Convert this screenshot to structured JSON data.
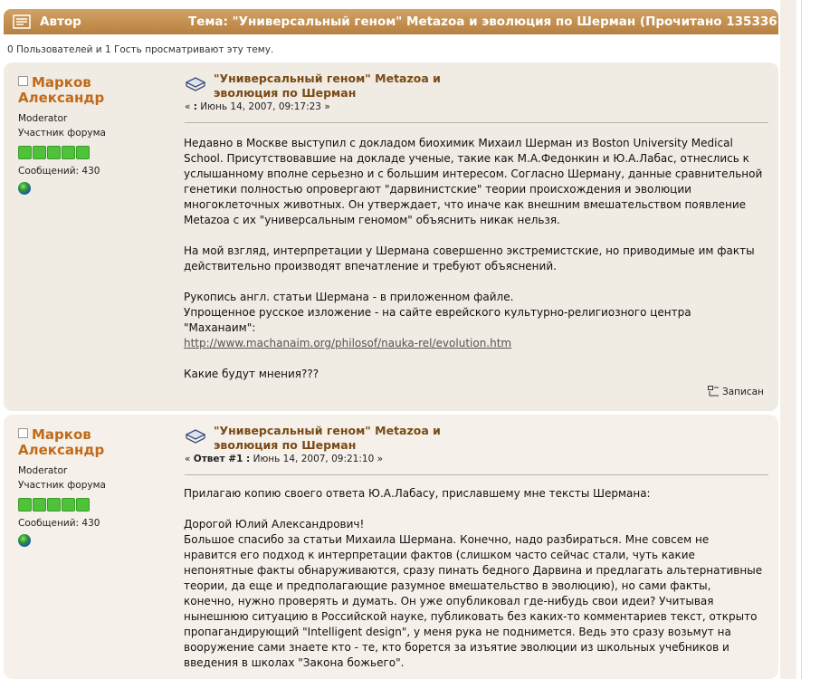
{
  "header": {
    "author_col": "Автор",
    "topic_col": "Тема: \"Универсальный геном\" Metazoa и эволюция по Шерман  (Прочитано 135336"
  },
  "viewers": "0 Пользователей и 1 Гость просматривают эту тему.",
  "posts": [
    {
      "author": "Марков Александр",
      "role": "Moderator",
      "group": "Участник форума",
      "posts_count": "Сообщений: 430",
      "title_line1": "\"Универсальный геном\" Metazoa и",
      "title_line2": "эволюция по Шерман",
      "date_prefix": "« ",
      "date_bold": ":",
      "date_rest": " Июнь 14, 2007, 09:17:23 »",
      "body": [
        "Недавно в Москве выступил с докладом биохимик Михаил Шерман из Boston University Medical School. Присутствовавшие на докладе ученые, такие как М.А.Федонкин и Ю.А.Лабас, отнеслись к услышанному вполне серьезно и с большим интересом. Согласно Шерману, данные сравнительной генетики полностью опровергают \"дарвинистские\" теории происхождения и эволюции многоклеточных животных. Он утверждает, что иначе как внешним вмешательством появление Metazoa с их \"универсальным геномом\" объяснить никак нельзя.",
        "На мой взгляд, интерпретации у Шермана совершенно экстремистские, но приводимые им факты действительно производят впечатление и требуют объяснений.",
        "Рукопись англ. статьи Шермана - в приложенном файле.",
        "Упрощенное русское изложение - на сайте еврейского культурно-религиозного центра \"Маханаим\":",
        "http://www.machanaim.org/philosof/nauka-rel/evolution.htm",
        "Какие будут мнения???"
      ],
      "quote_label": "Записан"
    },
    {
      "author": "Марков Александр",
      "role": "Moderator",
      "group": "Участник форума",
      "posts_count": "Сообщений: 430",
      "title_line1": "\"Универсальный геном\" Metazoa и",
      "title_line2": "эволюция по Шерман",
      "date_prefix": "« ",
      "date_bold": "Ответ #1 :",
      "date_rest": " Июнь 14, 2007, 09:21:10 »",
      "body": [
        "Прилагаю копию своего ответа Ю.А.Лабасу, приславшему мне тексты Шермана:",
        "Дорогой Юлий Александрович!",
        "Большое спасибо за статьи Михаила Шермана. Конечно, надо разбираться. Мне совсем не нравится его подход к интерпретации фактов (слишком часто сейчас стали, чуть какие непонятные факты обнаруживаются, сразу пинать бедного Дарвина и предлагать альтернативные теории, да еще и предполагающие разумное вмешательство в эволюцию), но сами факты, конечно, нужно проверять и думать. Он уже опубликовал где-нибудь свои идеи? Учитывая нынешнюю ситуацию в Российской науке, публиковать без каких-то комментариев текст, открыто пропагандирующий \"Intelligent design\", у меня рука не поднимется. Ведь это сразу возьмут на вооружение сами знаете кто - те, кто борется за изъятие эволюции из школьных учебников и введения в школах \"Закона божьего\"."
      ]
    }
  ]
}
